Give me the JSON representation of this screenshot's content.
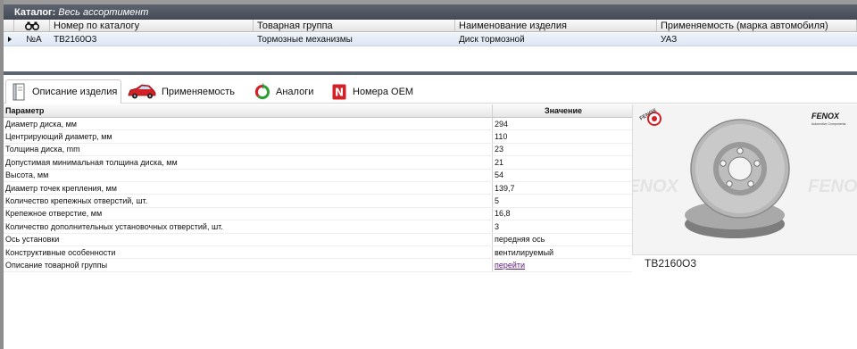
{
  "catalog": {
    "label": "Каталог:",
    "value": "Весь ассортимент"
  },
  "grid": {
    "headers": [
      "",
      "",
      "Номер по каталогу",
      "Товарная группа",
      "Наименование изделия",
      "Применяемость (марка автомобиля)"
    ],
    "rows": [
      {
        "mark": "№A",
        "catalog_number": "TB2160O3",
        "group": "Тормозные механизмы",
        "name": "Диск тормозной",
        "brand": "УАЗ"
      }
    ]
  },
  "tabs": [
    {
      "label": "Описание изделия",
      "icon": "book-icon",
      "active": true
    },
    {
      "label": "Применяемость",
      "icon": "car-icon",
      "active": false
    },
    {
      "label": "Аналоги",
      "icon": "recycle-icon",
      "active": false
    },
    {
      "label": "Номера OEM",
      "icon": "n-badge-icon",
      "active": false
    }
  ],
  "params": {
    "header_name": "Параметр",
    "header_value": "Значение",
    "rows": [
      {
        "name": "Диаметр диска, мм",
        "value": "294"
      },
      {
        "name": "Центрирующий диаметр, мм",
        "value": "110"
      },
      {
        "name": "Толщина диска, mm",
        "value": "23"
      },
      {
        "name": "Допустимая минимальная толщина диска, мм",
        "value": "21"
      },
      {
        "name": "Высота, мм",
        "value": "54"
      },
      {
        "name": "Диаметр точек крепления, мм",
        "value": "139,7"
      },
      {
        "name": "Количество крепежных отверстий, шт.",
        "value": "5"
      },
      {
        "name": "Крепежное отверстие, мм",
        "value": "16,8"
      },
      {
        "name": "Количество дополнительных установочных отверстий, шт.",
        "value": "3"
      },
      {
        "name": "Ось установки",
        "value": "передняя ось"
      },
      {
        "name": "Конструктивные особенности",
        "value": "вентилируемый"
      },
      {
        "name": "Описание товарной группы",
        "value": "перейти",
        "link": true
      }
    ]
  },
  "photo": {
    "brand": "FENOX",
    "brand_tagline": "Automotive Components",
    "watermark": "FENOX",
    "caption": "TB2160O3"
  },
  "colors": {
    "header_bar": "#4f5662",
    "selected_row": "#e4ecf7",
    "link": "#5a1a7a",
    "brand_red": "#d31f26"
  }
}
